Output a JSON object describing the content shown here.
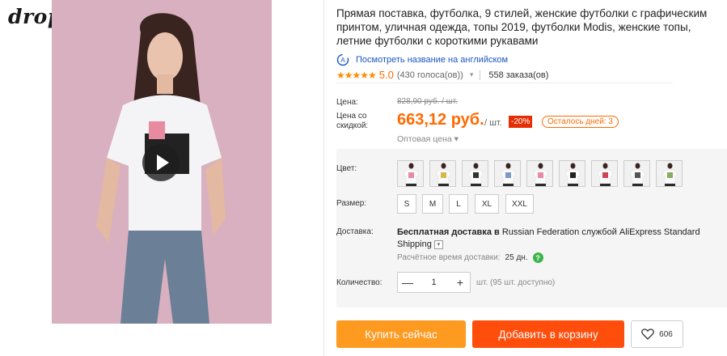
{
  "store": {
    "logo_text": "dropship"
  },
  "product": {
    "title": "Прямая поставка, футболка, 9 стилей, женские футболки с графическим принтом, уличная одежда, топы 2019, футболки Modis, женские топы, летние футболки с короткими рукавами",
    "translate_link": "Посмотреть название на английском",
    "rating": {
      "stars": "★★★★★",
      "value": "5.0",
      "votes": "(430 голоса(ов))",
      "orders": "558 заказа(ов)"
    }
  },
  "price": {
    "price_label": "Цена:",
    "sale_label": "Цена со скидкой:",
    "old_price": "828,90 руб. / шт.",
    "new_price": "663,12 руб.",
    "unit": "/ шт.",
    "discount": "-20%",
    "days_left": "Осталось дней: 3",
    "wholesale": "Оптовая цена ▾"
  },
  "options": {
    "color_label": "Цвет:",
    "color_count": 9,
    "size_label": "Размер:",
    "sizes": [
      "S",
      "M",
      "L",
      "XL",
      "XXL"
    ]
  },
  "shipping": {
    "label": "Доставка:",
    "bold_part": "Бесплатная доставка в",
    "rest_part": "Russian Federation службой AliExpress Standard Shipping",
    "dd_icon": "▾",
    "delivery_time_label": "Расчётное время доставки:",
    "delivery_time_value": "25 дн.",
    "help_glyph": "?"
  },
  "quantity": {
    "label": "Количество:",
    "minus": "—",
    "value": "1",
    "plus": "+",
    "note": "шт. (95 шт. доступно)"
  },
  "actions": {
    "buy_now": "Купить сейчас",
    "add_to_cart": "Добавить в корзину",
    "wishlist_count": "606"
  },
  "colors": {
    "accent": "#ff6a00",
    "buy": "#ff9a20",
    "cart": "#ff4d0b",
    "discount": "#e62e04",
    "help": "#3bb54a",
    "link": "#1a55c4"
  }
}
